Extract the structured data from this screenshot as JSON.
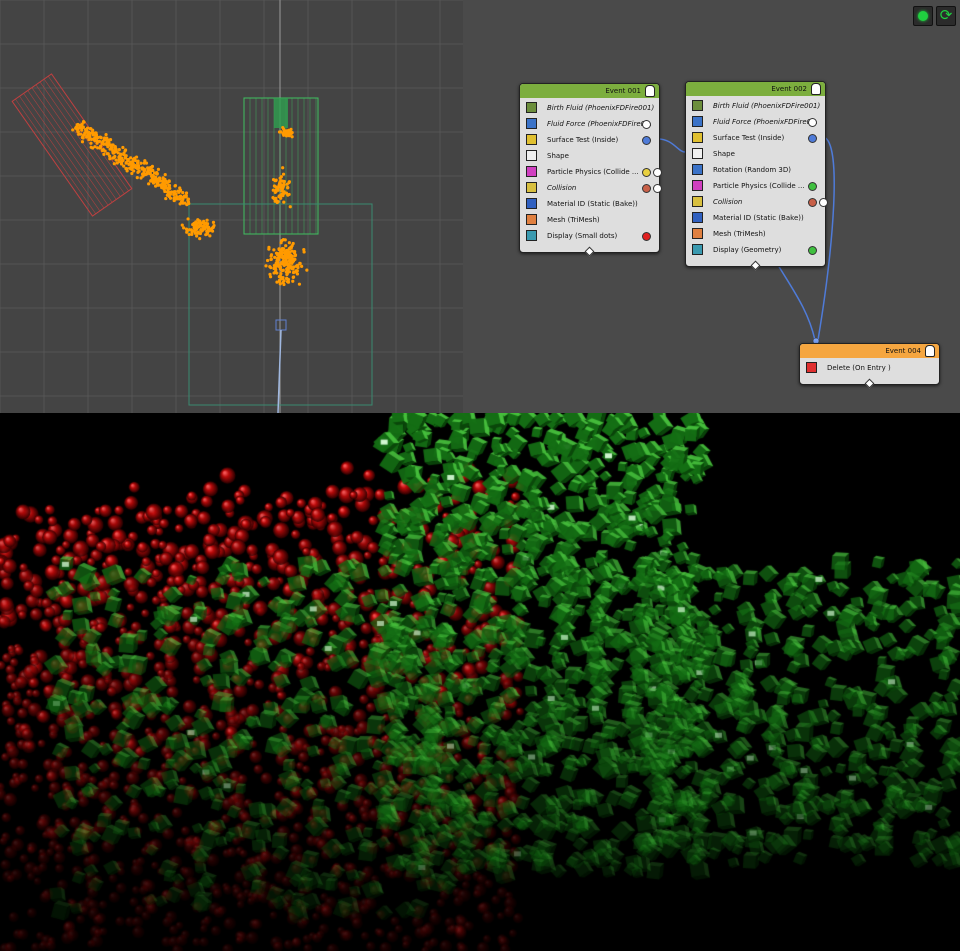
{
  "pflow": {
    "events": [
      {
        "title": "Event 001",
        "header_color": "#7cae3e",
        "operators": [
          {
            "label": "Birth Fluid (PhoenixFDFire001)",
            "italic": true,
            "icon": "birth-icon",
            "icon_color": "#6c8e3c"
          },
          {
            "label": "Fluid Force (PhoenixFDFire0...",
            "italic": true,
            "icon": "force-icon",
            "icon_color": "#3b73c8",
            "port": "#ffffff"
          },
          {
            "label": "Surface Test (Inside)",
            "italic": false,
            "icon": "test-icon",
            "icon_color": "#e0c030",
            "port": "#4f7bd8"
          },
          {
            "label": "Shape",
            "italic": false,
            "icon": "shape-icon",
            "icon_color": "#f0f0f0"
          },
          {
            "label": "Particle Physics (Collide ...",
            "italic": false,
            "icon": "physics-icon",
            "icon_color": "#d040c0",
            "port": "#e8d040"
          },
          {
            "label": "Collision",
            "italic": true,
            "icon": "collision-icon",
            "icon_color": "#d8c040",
            "port": "#c86048"
          },
          {
            "label": "Material ID (Static (Bake))",
            "italic": false,
            "icon": "material-icon",
            "icon_color": "#3060c0"
          },
          {
            "label": "Mesh (TriMesh)",
            "italic": false,
            "icon": "mesh-icon",
            "icon_color": "#e08040"
          },
          {
            "label": "Display (Small dots)",
            "italic": false,
            "icon": "display-icon",
            "icon_color": "#3a9ab0",
            "port": "#e02020"
          }
        ]
      },
      {
        "title": "Event 002",
        "header_color": "#7cae3e",
        "operators": [
          {
            "label": "Birth Fluid (PhoenixFDFire001)",
            "italic": true,
            "icon": "birth-icon",
            "icon_color": "#6c8e3c"
          },
          {
            "label": "Fluid Force (PhoenixFDFire0...",
            "italic": true,
            "icon": "force-icon",
            "icon_color": "#3b73c8",
            "port": "#ffffff"
          },
          {
            "label": "Surface Test (Inside)",
            "italic": false,
            "icon": "test-icon",
            "icon_color": "#e0c030",
            "port": "#4f7bd8"
          },
          {
            "label": "Shape",
            "italic": false,
            "icon": "shape-icon",
            "icon_color": "#f0f0f0"
          },
          {
            "label": "Rotation (Random 3D)",
            "italic": false,
            "icon": "rotation-icon",
            "icon_color": "#3b73c8"
          },
          {
            "label": "Particle Physics (Collide ...",
            "italic": false,
            "icon": "physics-icon",
            "icon_color": "#d040c0",
            "port": "#40c040"
          },
          {
            "label": "Collision",
            "italic": true,
            "icon": "collision-icon",
            "icon_color": "#d8c040",
            "port": "#c86048"
          },
          {
            "label": "Material ID (Static (Bake))",
            "italic": false,
            "icon": "material-icon",
            "icon_color": "#3060c0"
          },
          {
            "label": "Mesh (TriMesh)",
            "italic": false,
            "icon": "mesh-icon",
            "icon_color": "#e08040"
          },
          {
            "label": "Display (Geometry)",
            "italic": false,
            "icon": "display-icon",
            "icon_color": "#3a9ab0",
            "port": "#40c040"
          }
        ]
      },
      {
        "title": "Event 004",
        "header_color": "#f5a640",
        "operators": [
          {
            "label": "Delete (On Entry )",
            "italic": false,
            "icon": "delete-icon",
            "icon_color": "#e03030"
          }
        ]
      }
    ],
    "toolbar": [
      {
        "icon": "green-dot-icon",
        "color": "#20d040"
      },
      {
        "icon": "refresh-icon",
        "color": "#20d040"
      }
    ]
  },
  "colors": {
    "viewport_bg": "#444444",
    "grid": "#555555",
    "particles_orange": "#ff9a00",
    "wire": "#4f7bd8",
    "emitter_red": "#c04040",
    "emitter_green": "#40c060",
    "render_red": "#c01010",
    "render_green": "#22a022"
  }
}
